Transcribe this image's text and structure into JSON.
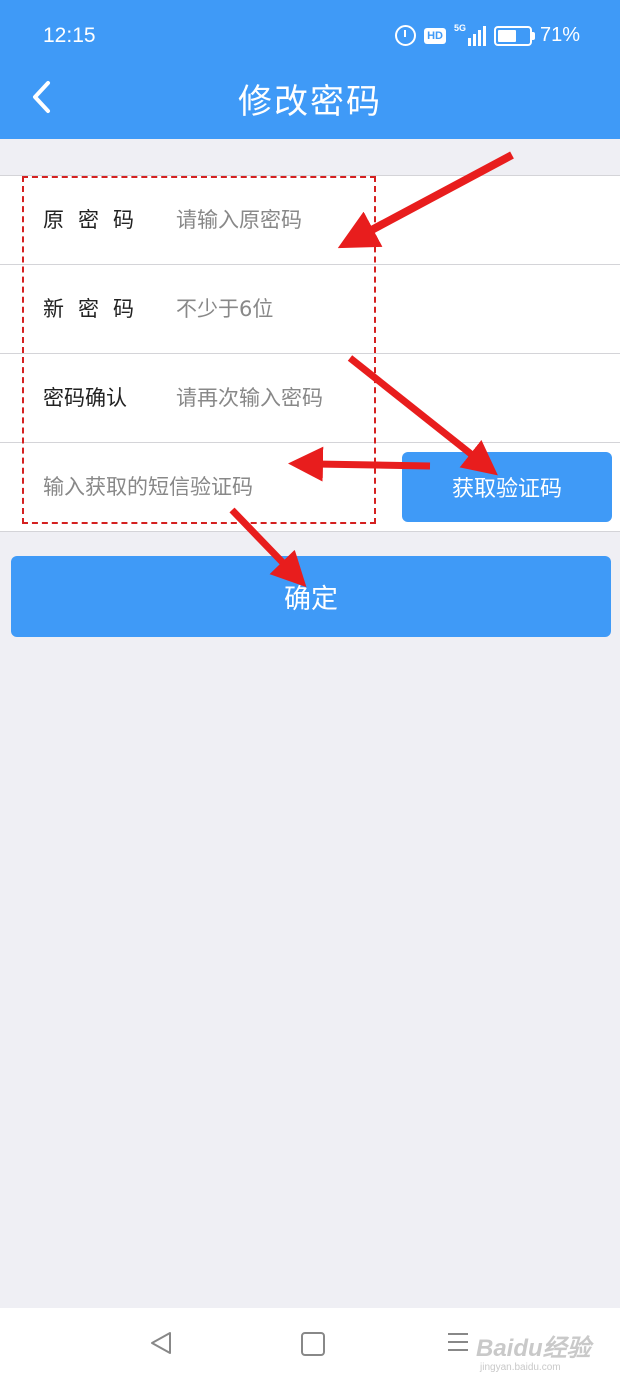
{
  "status_bar": {
    "time": "12:15",
    "hd": "HD",
    "network": "5G",
    "battery_text": "71%",
    "battery_level": 0.71
  },
  "header": {
    "title": "修改密码"
  },
  "form": {
    "old_password": {
      "label": "原密码",
      "placeholder": "请输入原密码"
    },
    "new_password": {
      "label": "新密码",
      "placeholder": "不少于6位"
    },
    "confirm_password": {
      "label": "密码确认",
      "placeholder": "请再次输入密码"
    },
    "sms_code": {
      "placeholder": "输入获取的短信验证码",
      "button_label": "获取验证码"
    }
  },
  "submit_label": "确定",
  "watermark": {
    "main": "Baidu经验",
    "sub": "jingyan.baidu.com"
  },
  "colors": {
    "primary": "#3f9af7",
    "annotation": "#d42020",
    "background": "#efeff4"
  }
}
